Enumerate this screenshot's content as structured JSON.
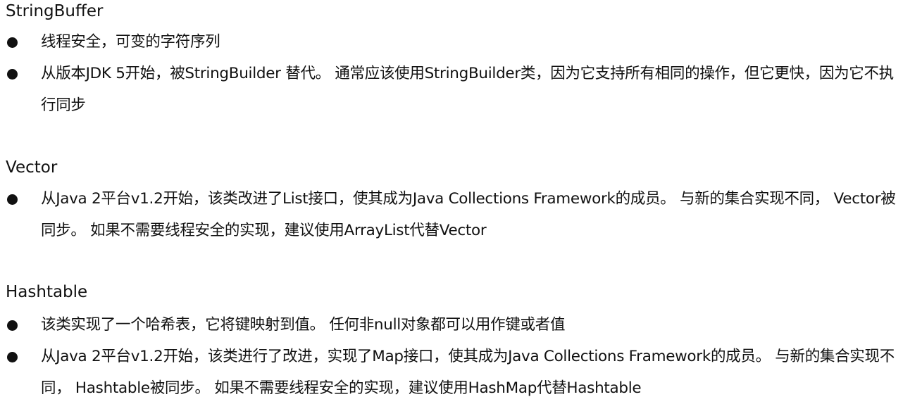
{
  "sections": [
    {
      "title": "StringBuffer",
      "items": [
        "线程安全，可变的字符序列",
        "从版本JDK 5开始，被StringBuilder 替代。 通常应该使用StringBuilder类，因为它支持所有相同的操作，但它更快，因为它不执行同步"
      ]
    },
    {
      "title": "Vector",
      "items": [
        "从Java 2平台v1.2开始，该类改进了List接口，使其成为Java Collections Framework的成员。 与新的集合实现不同， Vector被同步。 如果不需要线程安全的实现，建议使用ArrayList代替Vector"
      ]
    },
    {
      "title": "Hashtable",
      "items": [
        "该类实现了一个哈希表，它将键映射到值。 任何非null对象都可以用作键或者值",
        "从Java 2平台v1.2开始，该类进行了改进，实现了Map接口，使其成为Java Collections Framework的成员。 与新的集合实现不同， Hashtable被同步。 如果不需要线程安全的实现，建议使用HashMap代替Hashtable"
      ]
    }
  ]
}
